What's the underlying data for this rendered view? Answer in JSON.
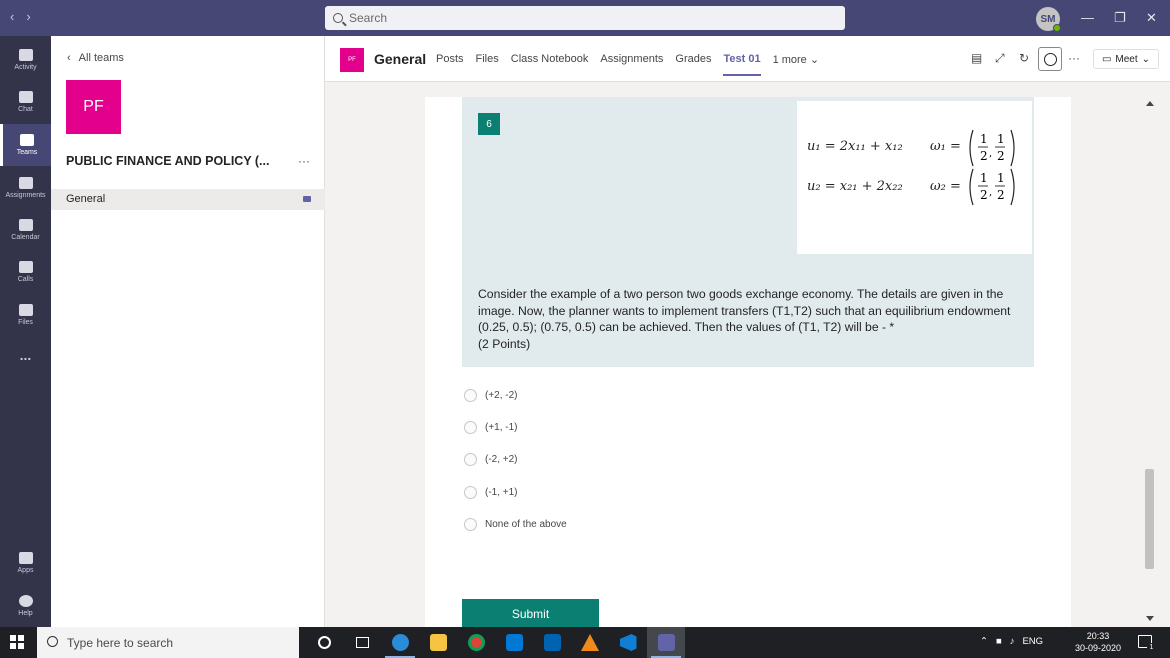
{
  "titlebar": {
    "search_placeholder": "Search",
    "avatar_initials": "SM",
    "window_controls": [
      "—",
      "❐",
      "✕"
    ]
  },
  "rail": {
    "items": [
      {
        "label": "Activity",
        "icon": "bell-icon"
      },
      {
        "label": "Chat",
        "icon": "chat-icon"
      },
      {
        "label": "Teams",
        "icon": "teams-icon"
      },
      {
        "label": "Assignments",
        "icon": "assignments-icon"
      },
      {
        "label": "Calendar",
        "icon": "calendar-icon"
      },
      {
        "label": "Calls",
        "icon": "phone-icon"
      },
      {
        "label": "Files",
        "icon": "file-icon"
      },
      {
        "label": "...",
        "icon": "more-icon"
      },
      {
        "label": "Apps",
        "icon": "apps-icon"
      },
      {
        "label": "Help",
        "icon": "help-icon"
      }
    ]
  },
  "teampanel": {
    "back_label": "All teams",
    "tile_initials": "PF",
    "team_name": "PUBLIC FINANCE AND POLICY (...",
    "more": "···",
    "channel": "General"
  },
  "channel_header": {
    "tile_initials": "PF",
    "title": "General",
    "tabs": [
      {
        "label": "Posts"
      },
      {
        "label": "Files"
      },
      {
        "label": "Class Notebook"
      },
      {
        "label": "Assignments"
      },
      {
        "label": "Grades"
      },
      {
        "label": "Test 01",
        "active": true
      },
      {
        "label": "1 more ⌄"
      }
    ],
    "more": "···",
    "meet_label": "Meet"
  },
  "question": {
    "number": "6",
    "equations": {
      "u1": "u₁ = 2x₁₁ + x₁₂",
      "w1": "ω₁ =",
      "u2": "u₂ = x₂₁ + 2x₂₂",
      "w2": "ω₂ ="
    },
    "text": "Consider the example of a two person two goods exchange economy. The details are given in the image. Now, the planner wants to implement transfers (T1,T2) such that an equilibrium endowment (0.25, 0.5); (0.75, 0.5) can be achieved. Then the values of (T1, T2) will be - *",
    "points": "(2 Points)",
    "options": [
      "(+2, -2)",
      "(+1, -1)",
      "(-2, +2)",
      "(-1, +1)",
      "None of the above"
    ],
    "submit_label": "Submit"
  },
  "taskbar": {
    "search_placeholder": "Type here to search",
    "language": "ENG",
    "time": "20:33",
    "date": "30-09-2020",
    "notification_count": "1"
  },
  "colors": {
    "titlebar": "#464775",
    "rail": "#33344a",
    "team_tile": "#e3008c",
    "accent": "#6264a7",
    "form_teal": "#0b8072",
    "question_bg": "#e1ebee"
  }
}
